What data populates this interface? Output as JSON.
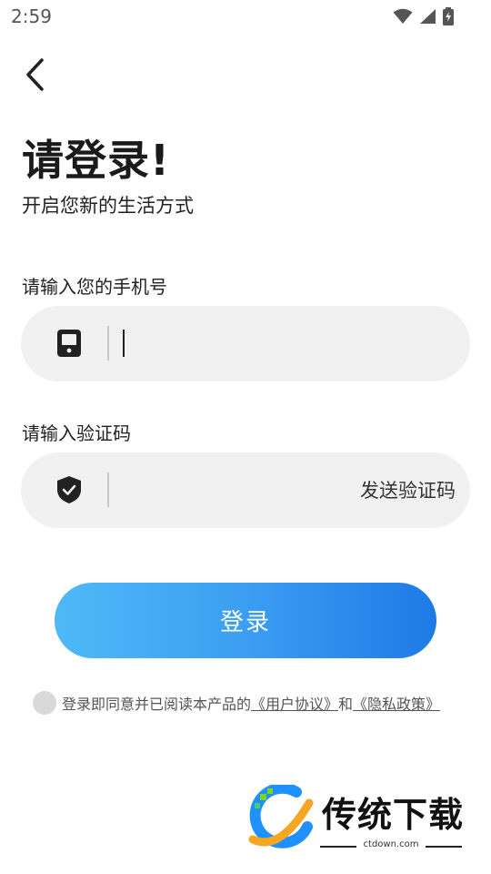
{
  "status": {
    "time": "2:59"
  },
  "header": {
    "title": "请登录!",
    "subtitle": "开启您新的生活方式"
  },
  "phone": {
    "label": "请输入您的手机号",
    "value": "",
    "placeholder": ""
  },
  "code": {
    "label": "请输入验证码",
    "value": "",
    "placeholder": "",
    "send_label": "发送验证码"
  },
  "login": {
    "label": "登录"
  },
  "agreement": {
    "text": "登录即同意并已阅读本产品的",
    "user_agreement": "《用户协议》",
    "and": "和",
    "privacy_policy": "《隐私政策》"
  },
  "watermark": {
    "brand": "传统下载",
    "url": "ctdown.com"
  },
  "colors": {
    "accent_start": "#4fb9f7",
    "accent_end": "#1e7ae6",
    "input_bg": "#f1f1f1"
  },
  "icons": {
    "phone": "phone-icon",
    "shield": "shield-check-icon",
    "back": "back-arrow-icon"
  }
}
